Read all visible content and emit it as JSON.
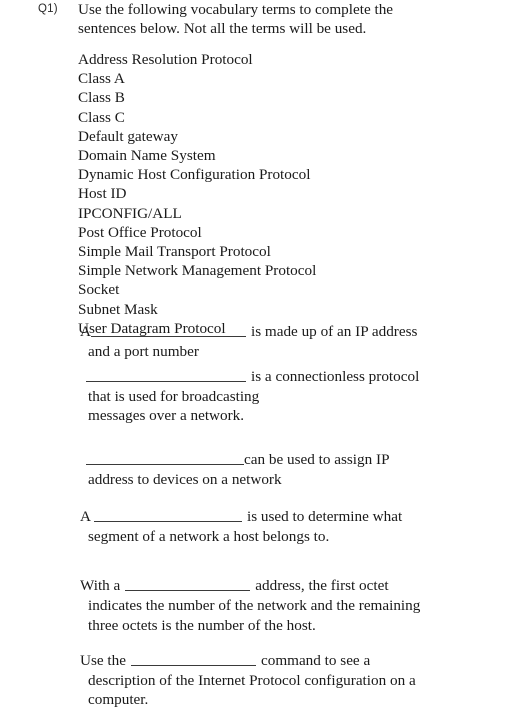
{
  "document": {
    "type": "worksheet-question",
    "background_color": "#ffffff",
    "text_color": "#1a1a1a"
  },
  "question": {
    "number_label": "Q1)",
    "prompt_line_1": "Use the following vocabulary terms to complete the",
    "prompt_line_2": "sentences below. Not all the terms will be used."
  },
  "vocabulary": {
    "terms": [
      "Address Resolution Protocol",
      "Class A",
      "Class B",
      "Class C",
      "Default gateway",
      "Domain Name System",
      "Dynamic Host Configuration Protocol",
      "Host ID",
      "IPCONFIG/ALL",
      "Post Office Protocol",
      "Simple Mail Transport Protocol",
      "Simple Network Management Protocol",
      "Socket",
      "Subnet Mask",
      "User Datagram Protocol"
    ]
  },
  "sentences": [
    {
      "id": "sentence-1",
      "before_blank": "A",
      "after_blank": "is made up of an IP address",
      "continuation": [
        "and a port number"
      ]
    },
    {
      "id": "sentence-2",
      "before_blank": "",
      "after_blank": "is a connectionless protocol",
      "continuation": [
        "that is used for broadcasting",
        "messages over a network."
      ]
    },
    {
      "id": "sentence-3",
      "before_blank": "",
      "after_blank": "can be used to assign IP",
      "continuation": [
        "address to devices on a network"
      ]
    },
    {
      "id": "sentence-4",
      "before_blank": "A",
      "after_blank": "is used to determine what",
      "continuation": [
        "segment of a network a host belongs to."
      ]
    },
    {
      "id": "sentence-5",
      "before_blank": "With a",
      "after_blank": "address, the first octet",
      "continuation": [
        "indicates the number of the network and the remaining",
        "three octets is the number of the host."
      ]
    },
    {
      "id": "sentence-6",
      "before_blank": "Use the",
      "after_blank": "command to see a",
      "continuation": [
        "description of the Internet Protocol configuration on a",
        "computer."
      ]
    }
  ]
}
